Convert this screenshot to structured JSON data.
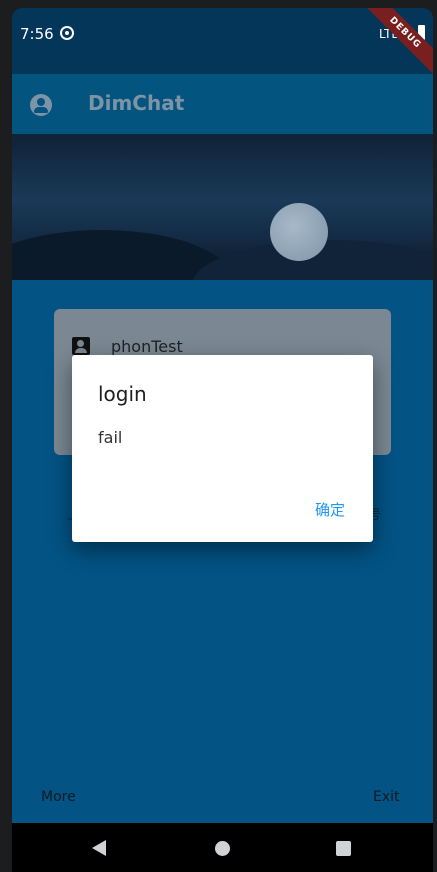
{
  "status_bar": {
    "time": "7:56",
    "network": "LTE",
    "sync_icon": "sync-icon",
    "signal_icon": "signal-icon",
    "battery_icon": "battery-icon"
  },
  "debug_banner": "DEBUG",
  "app_bar": {
    "title": "DimChat",
    "avatar_icon": "account-circle-icon"
  },
  "login_card": {
    "username": "phonTest",
    "user_icon": "contact-icon"
  },
  "footer": {
    "more_label": "More",
    "exit_label": "Exit"
  },
  "dialog": {
    "title": "login",
    "message": "fail",
    "confirm_label": "确定"
  },
  "underlay": {
    "left_text": "上",
    "right_text": "号"
  },
  "nav_bar": {
    "back_icon": "back-icon",
    "home_icon": "home-icon",
    "recents_icon": "recents-icon"
  },
  "colors": {
    "app_bar": "#03547f",
    "status_bar": "#033659",
    "main_bg": "#035385",
    "accent": "#2196f3"
  }
}
